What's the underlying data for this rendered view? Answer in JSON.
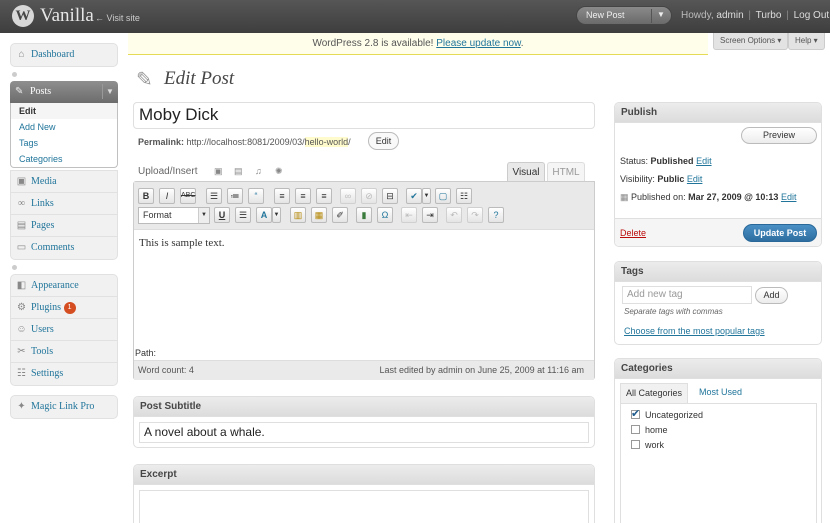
{
  "header": {
    "logo_letter": "W",
    "site_title": "Vanilla",
    "visit_site": "← Visit site",
    "new_post": "New Post",
    "howdy_prefix": "Howdy,",
    "username": "admin",
    "turbo": "Turbo",
    "logout": "Log Out"
  },
  "sidebar": {
    "dashboard": "Dashboard",
    "posts": "Posts",
    "posts_sub": [
      "Edit",
      "Add New",
      "Tags",
      "Categories"
    ],
    "media": "Media",
    "links": "Links",
    "pages": "Pages",
    "comments": "Comments",
    "appearance": "Appearance",
    "plugins": "Plugins",
    "plugins_badge": "1",
    "users": "Users",
    "tools": "Tools",
    "settings": "Settings",
    "magic_link": "Magic Link Pro"
  },
  "nag": {
    "text": "WordPress 2.8 is available!",
    "link": "Please update now",
    "suffix": "."
  },
  "meta_tabs": {
    "screen_options": "Screen Options ▾",
    "help": "Help ▾"
  },
  "page_title": "Edit Post",
  "post": {
    "title": "Moby Dick",
    "permalink_label": "Permalink:",
    "permalink_base": "http://localhost:8081/2009/03/",
    "permalink_slug": "hello-world",
    "permalink_tail": "/",
    "permalink_edit": "Edit"
  },
  "editor": {
    "upload_insert": "Upload/Insert",
    "tab_visual": "Visual",
    "tab_html": "HTML",
    "format_label": "Format",
    "content": "This is sample text.",
    "path_label": "Path:",
    "word_count": "Word count: 4",
    "last_edited": "Last edited by admin on June 25, 2009 at 11:16 am"
  },
  "subtitle_box": {
    "title": "Post Subtitle",
    "value": "A novel about a whale."
  },
  "excerpt_box": {
    "title": "Excerpt"
  },
  "publish": {
    "title": "Publish",
    "preview": "Preview",
    "status_label": "Status:",
    "status_value": "Published",
    "visibility_label": "Visibility:",
    "visibility_value": "Public",
    "published_label": "Published on:",
    "published_value": "Mar 27, 2009 @ 10:13",
    "edit": "Edit",
    "delete": "Delete",
    "update": "Update Post"
  },
  "tags": {
    "title": "Tags",
    "placeholder": "Add new tag",
    "add": "Add",
    "hint": "Separate tags with commas",
    "popular": "Choose from the most popular tags"
  },
  "categories": {
    "title": "Categories",
    "tab_all": "All Categories",
    "tab_used": "Most Used",
    "items": [
      {
        "label": "Uncategorized",
        "checked": true
      },
      {
        "label": "home",
        "checked": false
      },
      {
        "label": "work",
        "checked": false
      }
    ]
  }
}
